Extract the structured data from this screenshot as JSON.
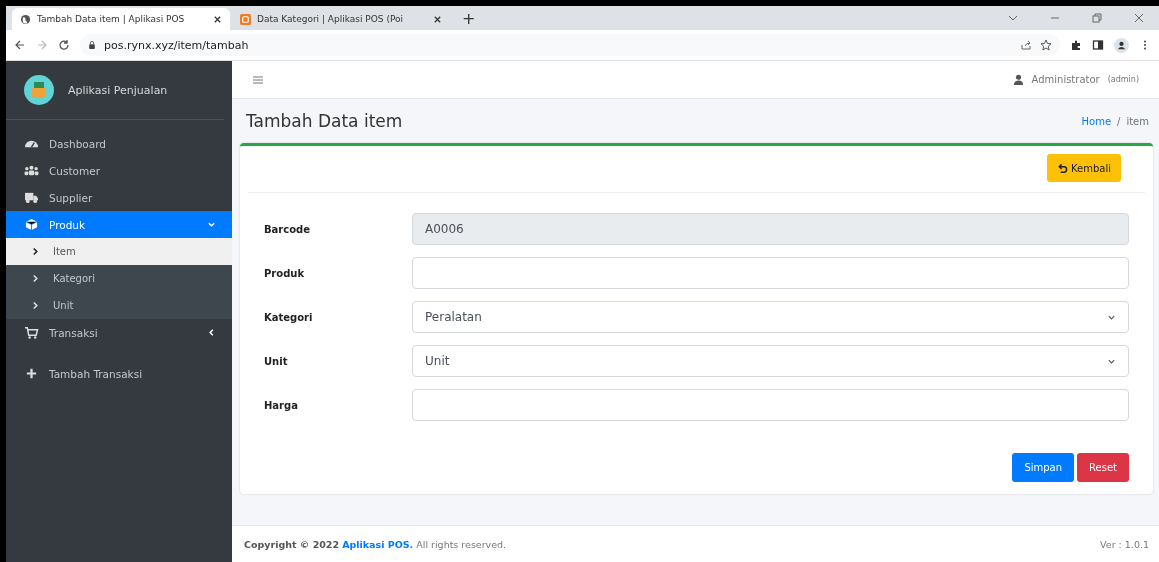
{
  "browser": {
    "tabs": [
      {
        "title": "Tambah Data item | Aplikasi POS",
        "selected": true
      },
      {
        "title": "Data Kategori | Aplikasi POS (Poi",
        "selected": false
      }
    ],
    "new_tab": "+",
    "address": "pos.rynx.xyz/item/tambah"
  },
  "sidebar": {
    "brand": "Aplikasi Penjualan",
    "items": [
      {
        "label": "Dashboard",
        "selected": false
      },
      {
        "label": "Customer",
        "selected": false
      },
      {
        "label": "Supplier",
        "selected": false
      },
      {
        "label": "Produk",
        "selected": true,
        "expanded": true,
        "children": [
          {
            "label": "Item",
            "selected": true
          },
          {
            "label": "Kategori",
            "selected": false
          },
          {
            "label": "Unit",
            "selected": false
          }
        ]
      },
      {
        "label": "Transaksi",
        "selected": false,
        "expanded": false
      },
      {
        "label": "Tambah Transaksi",
        "selected": false
      }
    ]
  },
  "navbar": {
    "user": "Administrator",
    "role": "(admin)"
  },
  "page": {
    "title": "Tambah Data item",
    "breadcrumb": {
      "items": [
        "Home",
        "item"
      ],
      "separator": "/"
    }
  },
  "form": {
    "back_button": "Kembali",
    "fields": [
      {
        "label": "Barcode",
        "kind": "readonly",
        "value": "A0006"
      },
      {
        "label": "Produk",
        "kind": "text"
      },
      {
        "label": "Kategori",
        "kind": "select",
        "value": "Peralatan"
      },
      {
        "label": "Unit",
        "kind": "select",
        "value": "Unit"
      },
      {
        "label": "Harga",
        "kind": "text"
      }
    ],
    "buttons": [
      {
        "label": "Simpan",
        "kind": "primary"
      },
      {
        "label": "Reset",
        "kind": "danger"
      }
    ]
  },
  "footer": {
    "copyright": "Copyright © 2022",
    "link": "Aplikasi POS.",
    "rights": "All rights reserved.",
    "version": "Ver : 1.0.1"
  }
}
